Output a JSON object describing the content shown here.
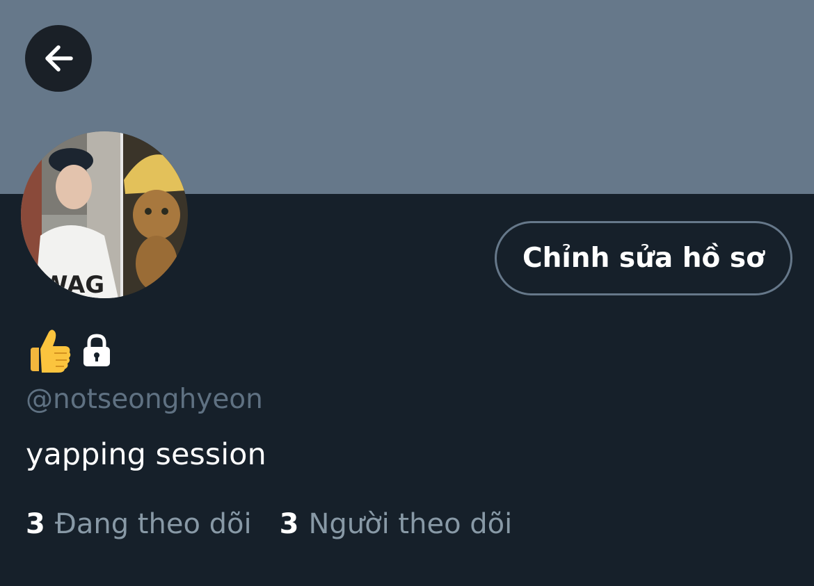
{
  "header": {
    "back_icon": "arrow-left-icon",
    "banner_color": "#66788a"
  },
  "profile": {
    "avatar_icon": "profile-photo",
    "edit_button_label": "Chỉnh sửa hồ sơ",
    "name_icons": [
      "thumbs-up-icon",
      "lock-icon"
    ],
    "handle": "@notseonghyeon",
    "bio": "yapping session"
  },
  "stats": {
    "following_count": "3",
    "following_label": "Đang theo dõi",
    "followers_count": "3",
    "followers_label": "Người theo dõi"
  },
  "colors": {
    "background": "#16202a",
    "muted_text": "#8899a6",
    "border": "#66788a"
  }
}
